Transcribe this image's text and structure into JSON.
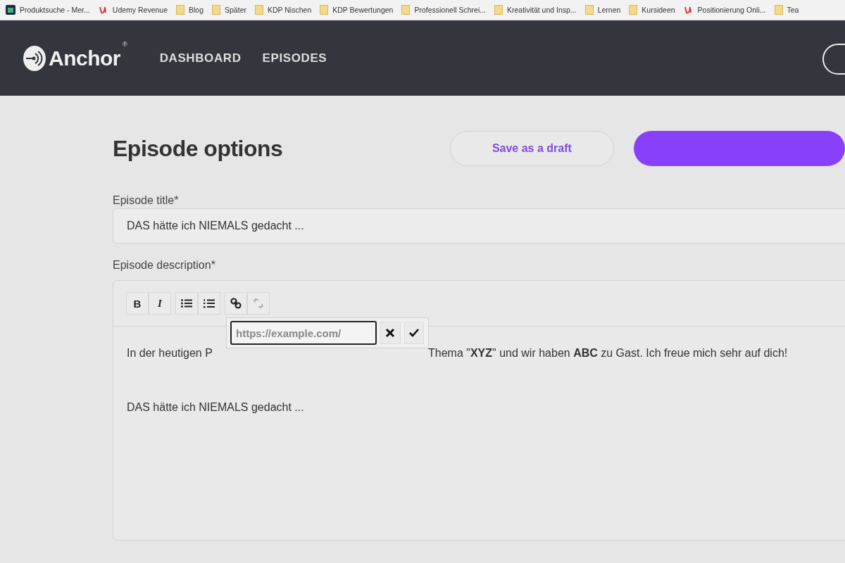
{
  "bookmarks": [
    {
      "label": "Produktsuche - Mer...",
      "kind": "app"
    },
    {
      "label": "Udemy Revenue",
      "kind": "udemy"
    },
    {
      "label": "Blog",
      "kind": "folder"
    },
    {
      "label": "Später",
      "kind": "folder"
    },
    {
      "label": "KDP Nischen",
      "kind": "folder"
    },
    {
      "label": "KDP Bewertungen",
      "kind": "folder"
    },
    {
      "label": "Professionell Schrei...",
      "kind": "folder"
    },
    {
      "label": "Kreativität und Insp...",
      "kind": "folder"
    },
    {
      "label": "Lernen",
      "kind": "folder"
    },
    {
      "label": "Kursideen",
      "kind": "folder"
    },
    {
      "label": "Positionierung Onli...",
      "kind": "udemy"
    },
    {
      "label": "Tea",
      "kind": "folder"
    }
  ],
  "header": {
    "logo": "Anchor",
    "logo_mark": "®",
    "nav": [
      {
        "label": "DASHBOARD"
      },
      {
        "label": "EPISODES"
      }
    ]
  },
  "page": {
    "title": "Episode options",
    "buttons": [
      {
        "label": "Save as a draft",
        "kind": "secondary"
      },
      {
        "kind": "primary"
      }
    ]
  },
  "title_field": {
    "label": "Episode title*",
    "value": "DAS hätte ich NIEMALS gedacht ..."
  },
  "description": {
    "label": "Episode description*",
    "toolbar": [
      [
        {
          "kind": "bold",
          "label": "B",
          "disabled": false
        },
        {
          "kind": "italic",
          "label": "I",
          "disabled": false
        }
      ],
      [
        {
          "kind": "bullet-list",
          "disabled": false
        },
        {
          "kind": "numbered-list",
          "disabled": false
        }
      ],
      [
        {
          "kind": "link",
          "disabled": false
        },
        {
          "kind": "unlink",
          "disabled": true
        }
      ]
    ],
    "link_popup": {
      "placeholder": "https://example.com/"
    },
    "paragraphs": [
      {
        "before_popup": "In der heutigen P",
        "after_popup": "Thema \"**XYZ**\" und wir haben **ABC** zu Gast. Ich freue mich sehr auf dich!"
      },
      {
        "text": "DAS hätte ich NIEMALS gedacht ..."
      }
    ]
  }
}
